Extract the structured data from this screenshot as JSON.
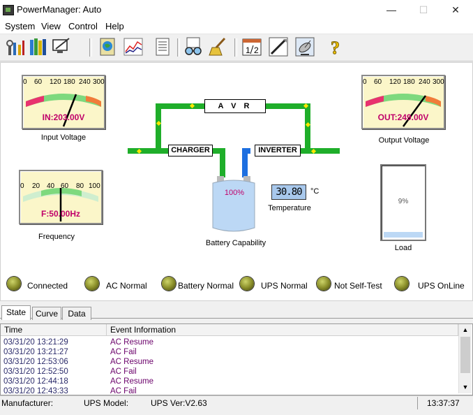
{
  "window": {
    "title": "PowerManager: Auto",
    "minimize_glyph": "—",
    "maximize_glyph": "☐",
    "close_glyph": "✕"
  },
  "menu": {
    "items": [
      "System",
      "View",
      "Control",
      "Help"
    ]
  },
  "toolbar": {
    "icons": [
      "tools-icon",
      "books-icon",
      "monitor-edit-icon",
      "globe-icon",
      "chart-icon",
      "list-icon",
      "glasses-icon",
      "broom-icon",
      "calendar-icon",
      "tool-pen-icon",
      "satellite-icon",
      "help-icon"
    ]
  },
  "gauges": {
    "input": {
      "scale": [
        "0",
        "60",
        "120",
        "180",
        "240",
        "300"
      ],
      "readout": "IN:203.00V",
      "caption": "Input Voltage",
      "value": 203
    },
    "output": {
      "scale": [
        "0",
        "60",
        "120",
        "180",
        "240",
        "300"
      ],
      "readout": "OUT:249.00V",
      "caption": "Output Voltage",
      "value": 249
    },
    "frequency": {
      "scale": [
        "0",
        "20",
        "40",
        "60",
        "80",
        "100"
      ],
      "readout": "F:50.00Hz",
      "caption": "Frequency",
      "value": 50
    }
  },
  "diagram": {
    "avr_label": "A V R",
    "charger_label": "CHARGER",
    "inverter_label": "INVERTER",
    "battery_percent": "100%",
    "battery_caption": "Battery Capability",
    "temperature_value": "30.80",
    "temperature_unit": "°C",
    "temperature_caption": "Temperature",
    "load_percent": "9%",
    "load_caption": "Load",
    "load_level": 0.09,
    "battery_level": 1.0
  },
  "status_indicators": [
    "Connected",
    "AC Normal",
    "Battery Normal",
    "UPS Normal",
    "Not Self-Test",
    "UPS OnLine"
  ],
  "tabs": [
    "State",
    "Curve",
    "Data"
  ],
  "log": {
    "columns": [
      "Time",
      "Event Information"
    ],
    "rows": [
      {
        "time": "03/31/20 13:21:29",
        "event": "AC Resume"
      },
      {
        "time": "03/31/20 13:21:27",
        "event": "AC Fail"
      },
      {
        "time": "03/31/20 12:53:06",
        "event": "AC Resume"
      },
      {
        "time": "03/31/20 12:52:50",
        "event": "AC Fail"
      },
      {
        "time": "03/31/20 12:44:18",
        "event": "AC Resume"
      },
      {
        "time": "03/31/20 12:43:33",
        "event": "AC Fail"
      }
    ]
  },
  "statusbar": {
    "manufacturer": "Manufacturer:",
    "model": "UPS Model:",
    "version": "UPS Ver:V2.63",
    "clock": "13:37:37"
  },
  "colors": {
    "bus_green": "#1fae2a",
    "inverter_blue": "#1d6fe0",
    "battery_fill": "#bcd8f5",
    "readout_text": "#c0006a"
  }
}
